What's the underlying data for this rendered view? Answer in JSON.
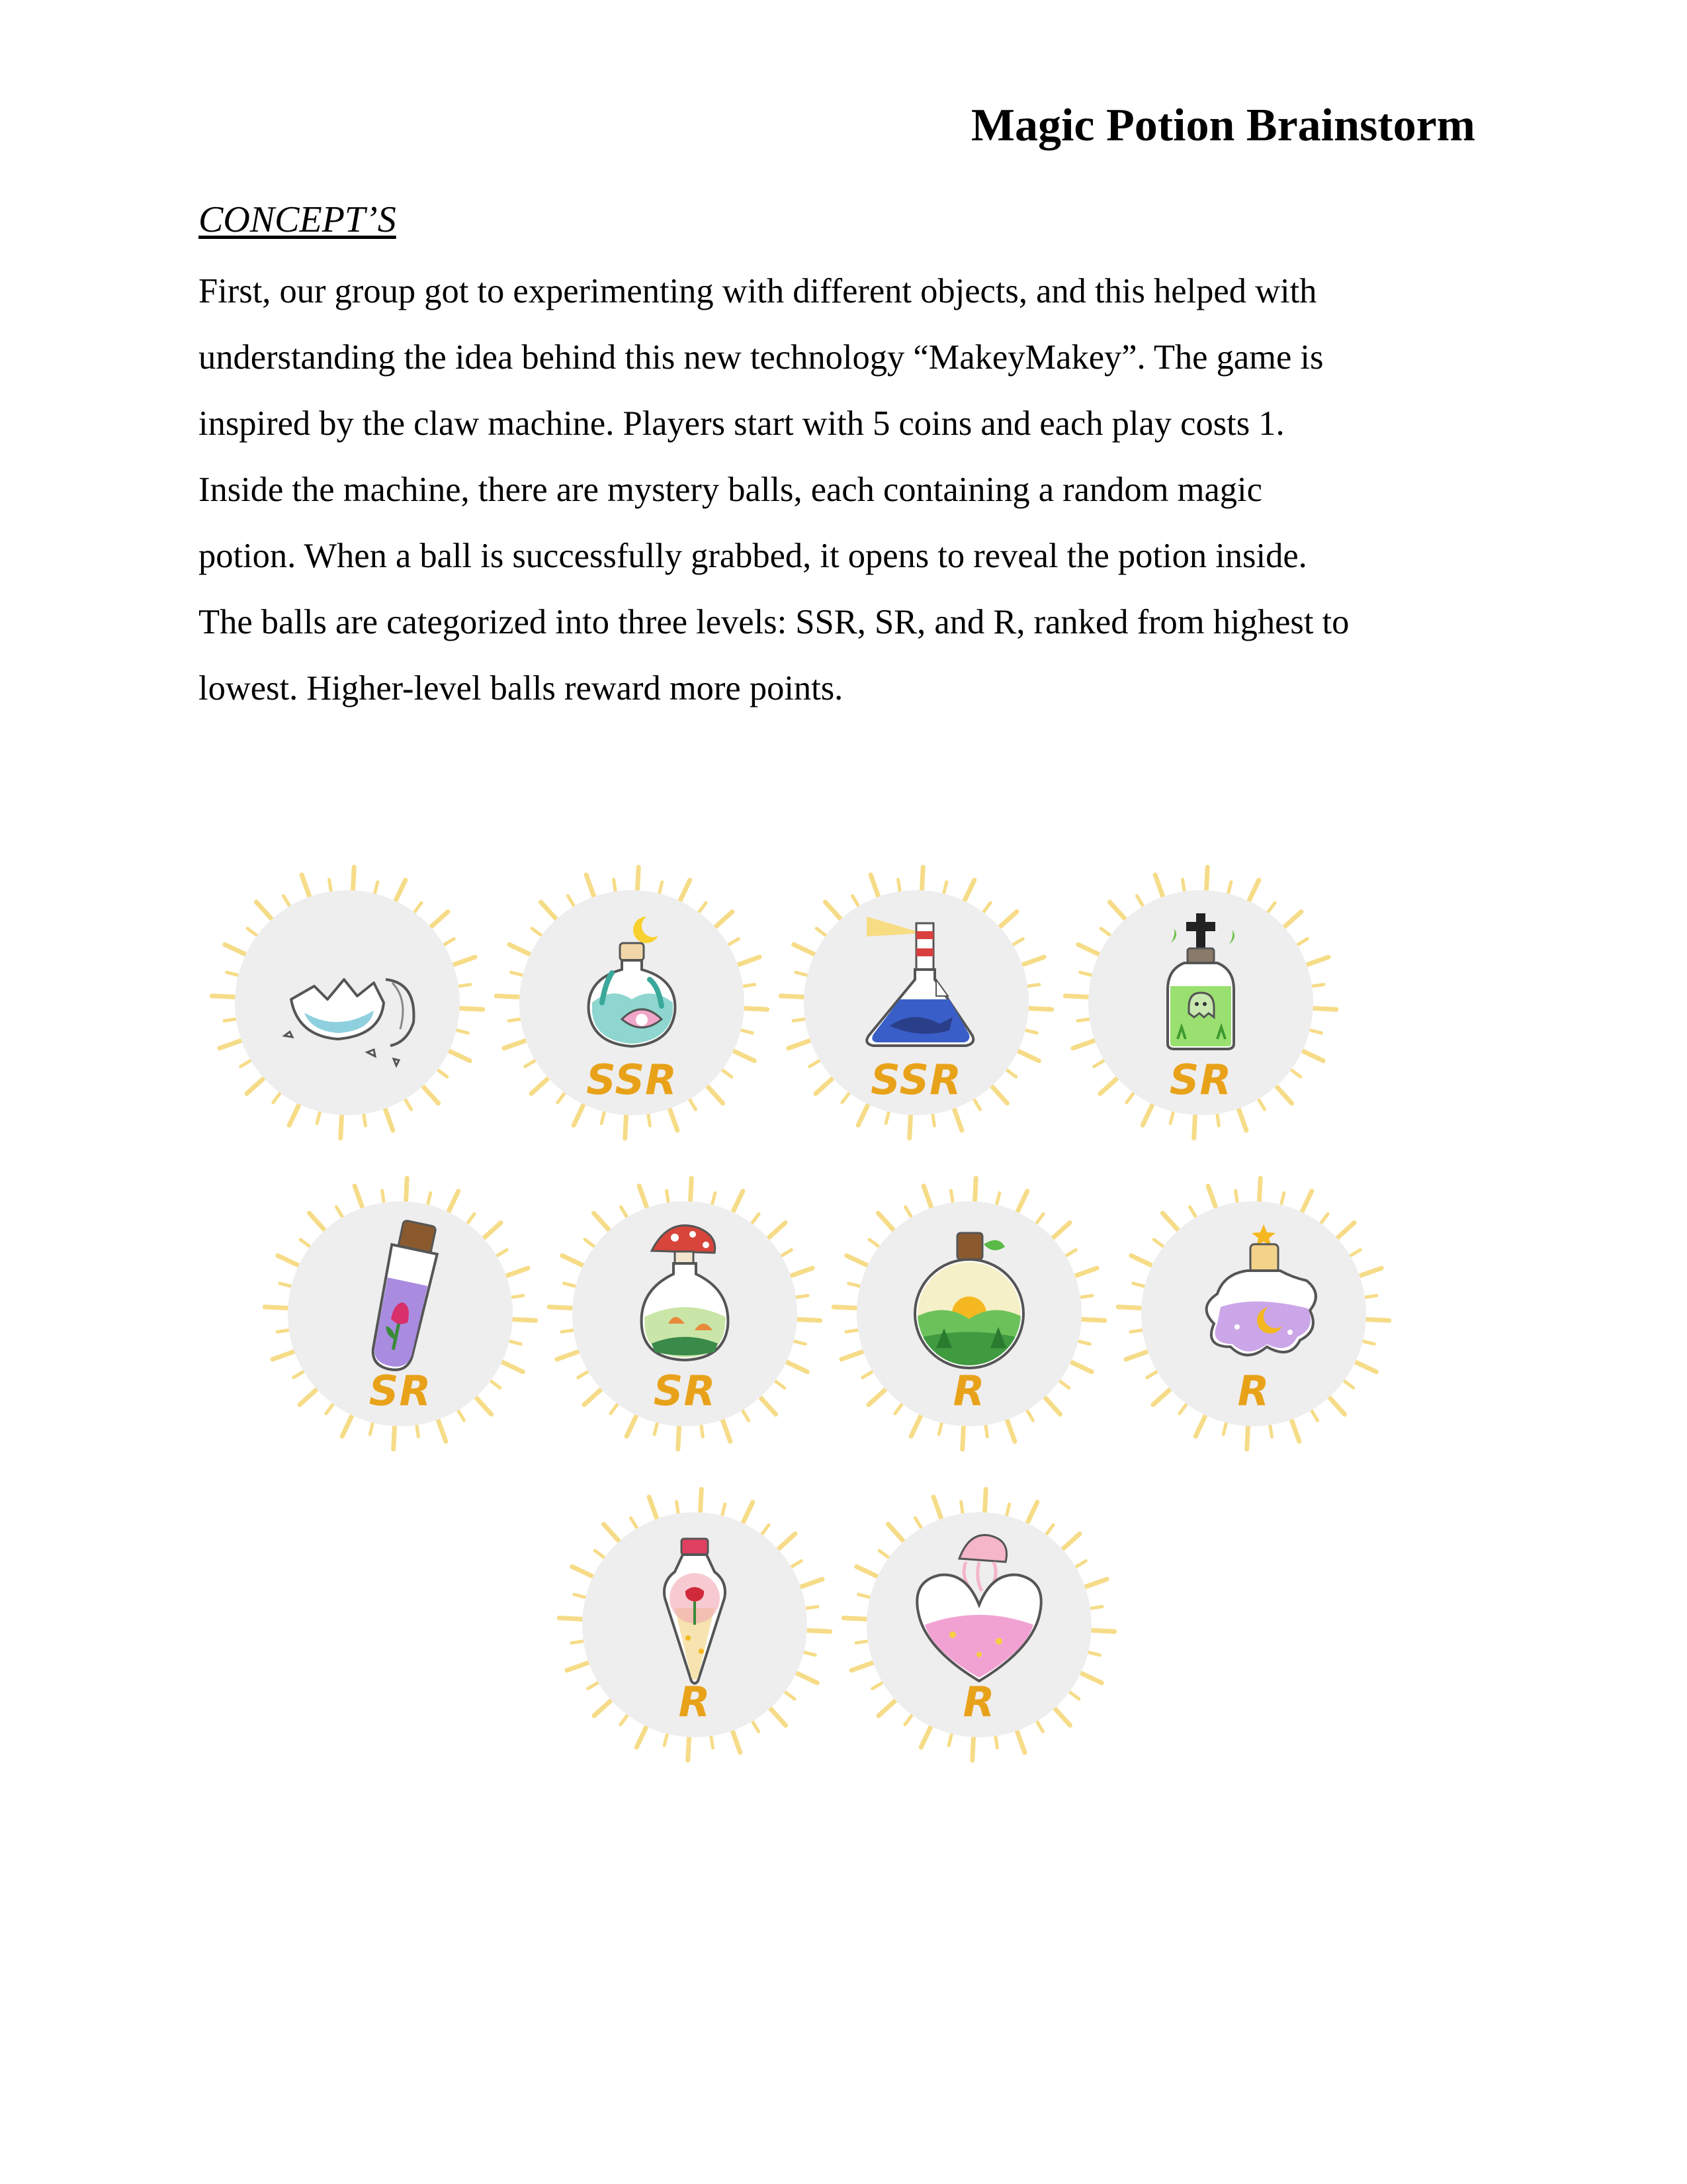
{
  "document": {
    "title": "Magic Potion Brainstorm",
    "section_heading": "CONCEPT’S",
    "body_lines": [
      "First, our group got to experimenting with different objects, and this helped with",
      "understanding the idea behind this new technology “MakeyMakey”. The game is",
      "inspired by the claw machine. Players start with 5 coins and each play costs 1.",
      "Inside the machine, there are mystery balls, each containing a random magic",
      "potion. When a ball is successfully grabbed, it opens to reveal the potion inside.",
      "The balls are categorized into three levels: SSR, SR, and R, ranked from highest to",
      "lowest. Higher-level balls reward more points."
    ]
  },
  "colors": {
    "rank_label": "#e8a21a",
    "ray": "#f6dc88",
    "badge_bg": "#efeeee"
  },
  "badges": [
    {
      "icon": "broken-mystery-ball-icon",
      "rank": ""
    },
    {
      "icon": "ocean-pearl-potion-icon",
      "rank": "SSR"
    },
    {
      "icon": "lighthouse-whale-potion-icon",
      "rank": "SSR"
    },
    {
      "icon": "ghost-cross-potion-icon",
      "rank": "SR"
    },
    {
      "icon": "tulip-tube-potion-icon",
      "rank": "SR"
    },
    {
      "icon": "mushroom-forest-potion-icon",
      "rank": "SR"
    },
    {
      "icon": "sunset-forest-potion-icon",
      "rank": "R"
    },
    {
      "icon": "moon-star-flower-potion-icon",
      "rank": "R"
    },
    {
      "icon": "rose-vial-potion-icon",
      "rank": "R"
    },
    {
      "icon": "jellyfish-heart-potion-icon",
      "rank": "R"
    }
  ]
}
